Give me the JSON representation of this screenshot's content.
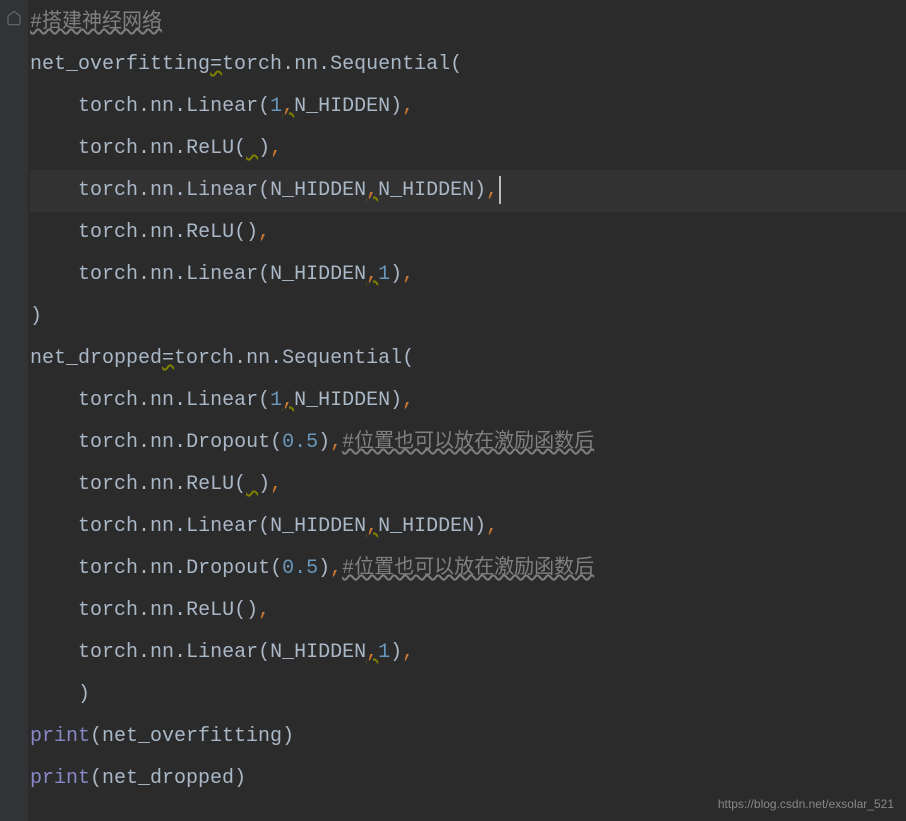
{
  "lines": {
    "l1_comment": "#搭建神经网络",
    "l2_var": "net_overfitting",
    "l2_eq": "=",
    "l2_torch": "torch",
    "l2_dot1": ".",
    "l2_nn": "nn",
    "l2_dot2": ".",
    "l2_seq": "Sequential",
    "l2_paren": "(",
    "l3_indent": "    ",
    "l3_torch": "torch",
    "l3_dot1": ".",
    "l3_nn": "nn",
    "l3_dot2": ".",
    "l3_linear": "Linear",
    "l3_p1": "(",
    "l3_num": "1",
    "l3_comma": ",",
    "l3_hidden": "N_HIDDEN",
    "l3_p2": ")",
    "l3_commaend": ",",
    "l4_indent": "    ",
    "l4_torch": "torch",
    "l4_dot1": ".",
    "l4_nn": "nn",
    "l4_dot2": ".",
    "l4_relu": "ReLU",
    "l4_p1": "(",
    "l4_sp": " ",
    "l4_p2": ")",
    "l4_comma": ",",
    "l5_indent": "    ",
    "l5_torch": "torch",
    "l5_dot1": ".",
    "l5_nn": "nn",
    "l5_dot2": ".",
    "l5_linear": "Linear",
    "l5_p1": "(",
    "l5_h1": "N_HIDDEN",
    "l5_comma": ",",
    "l5_h2": "N_HIDDEN",
    "l5_p2": ")",
    "l5_commaend": ",",
    "l6_indent": "    ",
    "l6_torch": "torch",
    "l6_dot1": ".",
    "l6_nn": "nn",
    "l6_dot2": ".",
    "l6_relu": "ReLU",
    "l6_p1": "(",
    "l6_p2": ")",
    "l6_comma": ",",
    "l7_indent": "    ",
    "l7_torch": "torch",
    "l7_dot1": ".",
    "l7_nn": "nn",
    "l7_dot2": ".",
    "l7_linear": "Linear",
    "l7_p1": "(",
    "l7_h": "N_HIDDEN",
    "l7_comma": ",",
    "l7_num": "1",
    "l7_p2": ")",
    "l7_commaend": ",",
    "l8_close": ")",
    "l9_var": "net_dropped",
    "l9_eq": "=",
    "l9_torch": "torch",
    "l9_dot1": ".",
    "l9_nn": "nn",
    "l9_dot2": ".",
    "l9_seq": "Sequential",
    "l9_paren": "(",
    "l10_indent": "    ",
    "l10_torch": "torch",
    "l10_dot1": ".",
    "l10_nn": "nn",
    "l10_dot2": ".",
    "l10_linear": "Linear",
    "l10_p1": "(",
    "l10_num": "1",
    "l10_comma": ",",
    "l10_hidden": "N_HIDDEN",
    "l10_p2": ")",
    "l10_commaend": ",",
    "l11_indent": "    ",
    "l11_torch": "torch",
    "l11_dot1": ".",
    "l11_nn": "nn",
    "l11_dot2": ".",
    "l11_dropout": "Dropout",
    "l11_p1": "(",
    "l11_num": "0.5",
    "l11_p2": ")",
    "l11_comma": ",",
    "l11_comment": "#位置也可以放在激励函数后",
    "l12_indent": "    ",
    "l12_torch": "torch",
    "l12_dot1": ".",
    "l12_nn": "nn",
    "l12_dot2": ".",
    "l12_relu": "ReLU",
    "l12_p1": "(",
    "l12_sp": " ",
    "l12_p2": ")",
    "l12_comma": ",",
    "l13_indent": "    ",
    "l13_torch": "torch",
    "l13_dot1": ".",
    "l13_nn": "nn",
    "l13_dot2": ".",
    "l13_linear": "Linear",
    "l13_p1": "(",
    "l13_h1": "N_HIDDEN",
    "l13_comma": ",",
    "l13_h2": "N_HIDDEN",
    "l13_p2": ")",
    "l13_commaend": ",",
    "l14_indent": "    ",
    "l14_torch": "torch",
    "l14_dot1": ".",
    "l14_nn": "nn",
    "l14_dot2": ".",
    "l14_dropout": "Dropout",
    "l14_p1": "(",
    "l14_num": "0.5",
    "l14_p2": ")",
    "l14_comma": ",",
    "l14_comment": "#位置也可以放在激励函数后",
    "l15_indent": "    ",
    "l15_torch": "torch",
    "l15_dot1": ".",
    "l15_nn": "nn",
    "l15_dot2": ".",
    "l15_relu": "ReLU",
    "l15_p1": "(",
    "l15_p2": ")",
    "l15_comma": ",",
    "l16_indent": "    ",
    "l16_torch": "torch",
    "l16_dot1": ".",
    "l16_nn": "nn",
    "l16_dot2": ".",
    "l16_linear": "Linear",
    "l16_p1": "(",
    "l16_h": "N_HIDDEN",
    "l16_comma": ",",
    "l16_num": "1",
    "l16_p2": ")",
    "l16_commaend": ",",
    "l17_indent": "    ",
    "l17_close": ")",
    "l18_print": "print",
    "l18_p1": "(",
    "l18_var": "net_overfitting",
    "l18_p2": ")",
    "l19_print": "print",
    "l19_p1": "(",
    "l19_var": "net_dropped",
    "l19_p2": ")"
  },
  "watermark": "https://blog.csdn.net/exsolar_521"
}
